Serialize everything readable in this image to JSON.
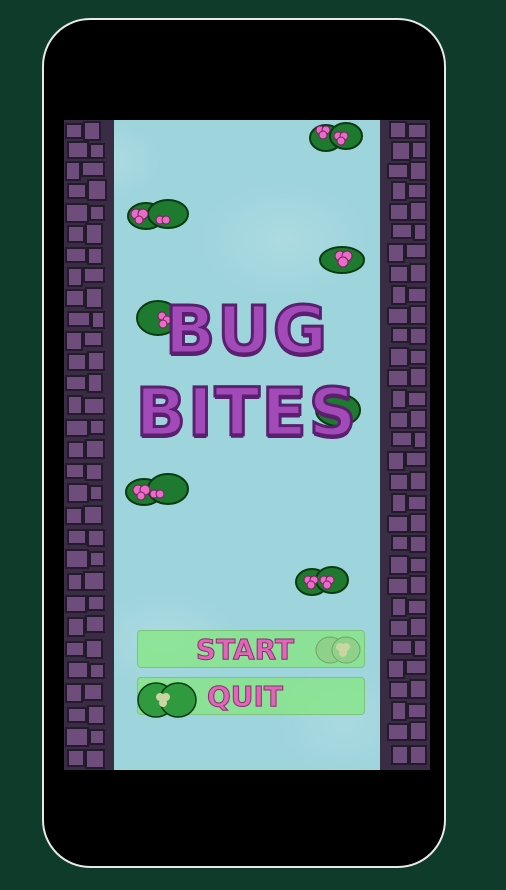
{
  "game": {
    "title_line1": "BUG",
    "title_line2": "BITES"
  },
  "menu": {
    "start_label": "START",
    "quit_label": "QUIT"
  },
  "colors": {
    "background": "#0f3b2a",
    "water": "#9ed4dc",
    "title": "#a24bb8",
    "button": "#84e87c",
    "button_text": "#e067b8",
    "wall": "#6a4a78"
  },
  "icons": [
    "lily-pad-icon",
    "flower-icon",
    "rock-wall"
  ]
}
